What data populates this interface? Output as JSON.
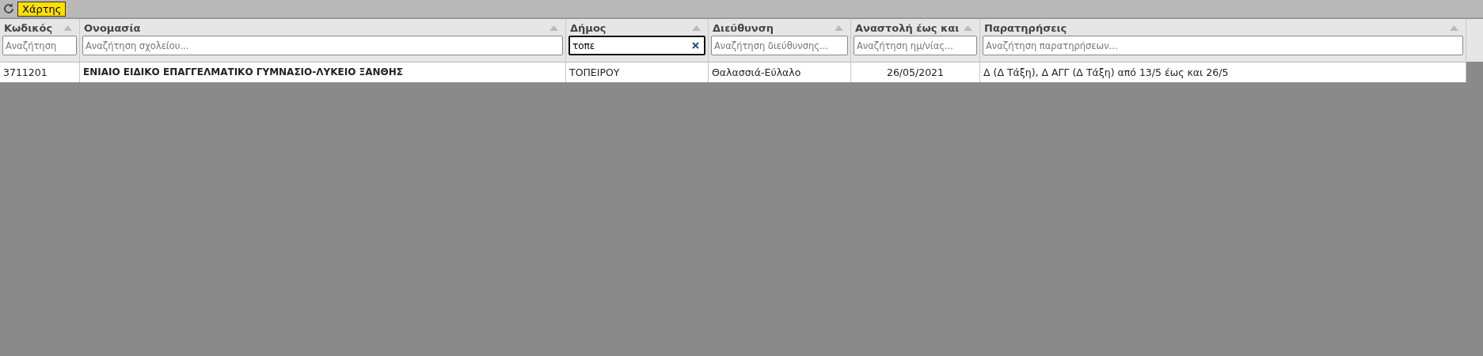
{
  "toolbar": {
    "map_button": "Χάρτης"
  },
  "table": {
    "columns": [
      {
        "label": "Κωδικός",
        "placeholder": "Αναζήτηση",
        "kind": "text"
      },
      {
        "label": "Ονομασία",
        "placeholder": "Αναζήτηση σχολείου...",
        "kind": "title"
      },
      {
        "label": "Δήμος",
        "value": "τοπε",
        "focused": true,
        "kind": "text"
      },
      {
        "label": "Διεύθυνση",
        "placeholder": "Αναζήτηση διεύθυνσης...",
        "kind": "text"
      },
      {
        "label": "Αναστολή έως και",
        "placeholder": "Αναζήτηση ημ/νίας...",
        "kind": "date"
      },
      {
        "label": "Παρατηρήσεις",
        "placeholder": "Αναζήτηση παρατηρήσεων...",
        "kind": "text"
      }
    ],
    "rows": [
      {
        "cells": [
          "3711201",
          "ΕΝΙΑΙΟ ΕΙΔΙΚΟ ΕΠΑΓΓΕΛΜΑΤΙΚΟ ΓΥΜΝΑΣΙΟ-ΛΥΚΕΙΟ ΞΑΝΘΗΣ",
          "ΤΟΠΕΙΡΟΥ",
          "Θαλασσιά-Εύλαλο",
          "26/05/2021",
          "Δ (Δ Τάξη), Δ ΑΓΓ (Δ Τάξη) από 13/5 έως και 26/5"
        ]
      }
    ]
  }
}
